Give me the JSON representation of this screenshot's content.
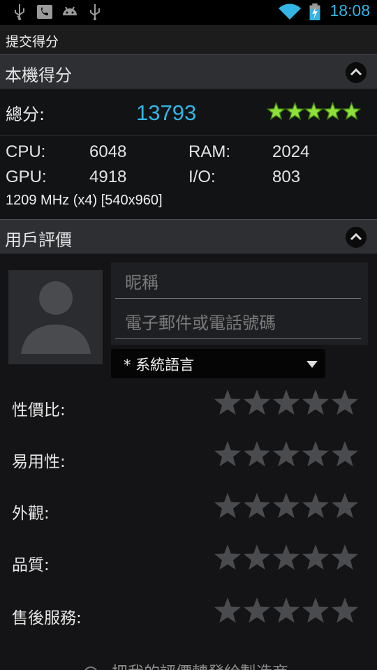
{
  "status_bar": {
    "time": "18:08",
    "icons": [
      "usb-icon",
      "phone-icon",
      "android-icon",
      "usb-icon",
      "wifi-icon",
      "battery-charging-icon"
    ]
  },
  "title_bar": {
    "title": "提交得分"
  },
  "score_section": {
    "title": "本機得分",
    "total_label": "總分:",
    "total_value": "13793",
    "stars": 5,
    "metrics": {
      "cpu_label": "CPU:",
      "cpu_value": "6048",
      "ram_label": "RAM:",
      "ram_value": "2024",
      "gpu_label": "GPU:",
      "gpu_value": "4918",
      "io_label": "I/O:",
      "io_value": "803"
    },
    "device_info": "1209 MHz (x4) [540x960]"
  },
  "review_section": {
    "title": "用戶評價",
    "nickname_placeholder": "昵稱",
    "contact_placeholder": "電子郵件或電話號碼",
    "language_value": "* 系統語言",
    "ratings": [
      {
        "label": "性價比:"
      },
      {
        "label": "易用性:"
      },
      {
        "label": "外觀:"
      },
      {
        "label": "品質:"
      },
      {
        "label": "售後服務:"
      }
    ],
    "agree_text": "把我的評價轉發給製造商"
  },
  "colors": {
    "accent": "#33b5e5",
    "star_green": "#8ee03a",
    "star_empty": "#4a4b4e",
    "header_bg": "#2d2f33"
  }
}
